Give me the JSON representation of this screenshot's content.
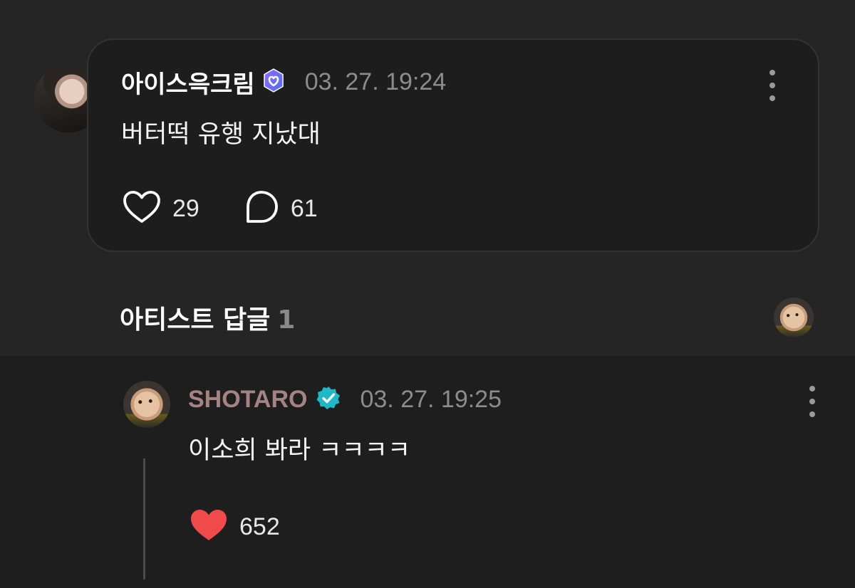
{
  "post": {
    "author": "아이스윽크림",
    "timestamp": "03. 27. 19:24",
    "text": "버터떡 유행 지났대",
    "likes": "29",
    "comments": "61",
    "badge_icon": "verified-heart-badge",
    "badge_color": "#7b5cff"
  },
  "artist_replies": {
    "title": "아티스트 답글",
    "count": "1"
  },
  "reply": {
    "author": "SHOTARO",
    "timestamp": "03. 27. 19:25",
    "text": "이소희 봐라 ㅋㅋㅋㅋ",
    "likes": "652",
    "badge_icon": "verified-check-badge",
    "badge_color": "#1fb8c9",
    "name_color": "#a68383",
    "like_color": "#f04a4a"
  }
}
